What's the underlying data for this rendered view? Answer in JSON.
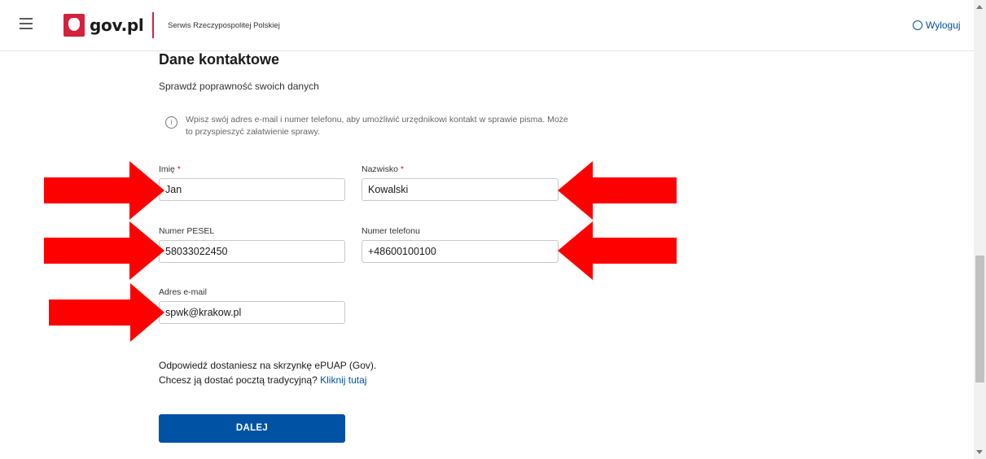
{
  "header": {
    "logo_text": "gov.pl",
    "service_name": "Serwis Rzeczypospolitej Polskiej",
    "logout_label": "Wyloguj"
  },
  "page": {
    "title": "Dane kontaktowe",
    "subtitle": "Sprawdź poprawność swoich danych",
    "info_text": "Wpisz swój adres e-mail i numer telefonu, aby umożliwić urzędnikowi kontakt w sprawie pisma. Może to przyspieszyć załatwienie sprawy."
  },
  "form": {
    "first_name": {
      "label": "Imię",
      "required_mark": "*",
      "value": "Jan"
    },
    "last_name": {
      "label": "Nazwisko",
      "required_mark": "*",
      "value": "Kowalski"
    },
    "pesel": {
      "label": "Numer PESEL",
      "value": "58033022450"
    },
    "phone": {
      "label": "Numer telefonu",
      "value": "+48600100100"
    },
    "email": {
      "label": "Adres e-mail",
      "value": "spwk@krakow.pl"
    }
  },
  "reply": {
    "line1": "Odpowiedź dostaniesz na skrzynkę ePUAP (Gov).",
    "line2": "Chcesz ją dostać pocztą tradycyjną?",
    "link": "Kliknij tutaj"
  },
  "next_button": "DALEJ",
  "colors": {
    "brand_blue": "#0052a5",
    "brand_red": "#d4213d",
    "arrow_red": "#ff0000"
  },
  "icons": [
    "menu-icon",
    "gov-emblem-icon",
    "user-icon",
    "info-icon",
    "arrow-right-icon",
    "arrow-left-icon"
  ]
}
